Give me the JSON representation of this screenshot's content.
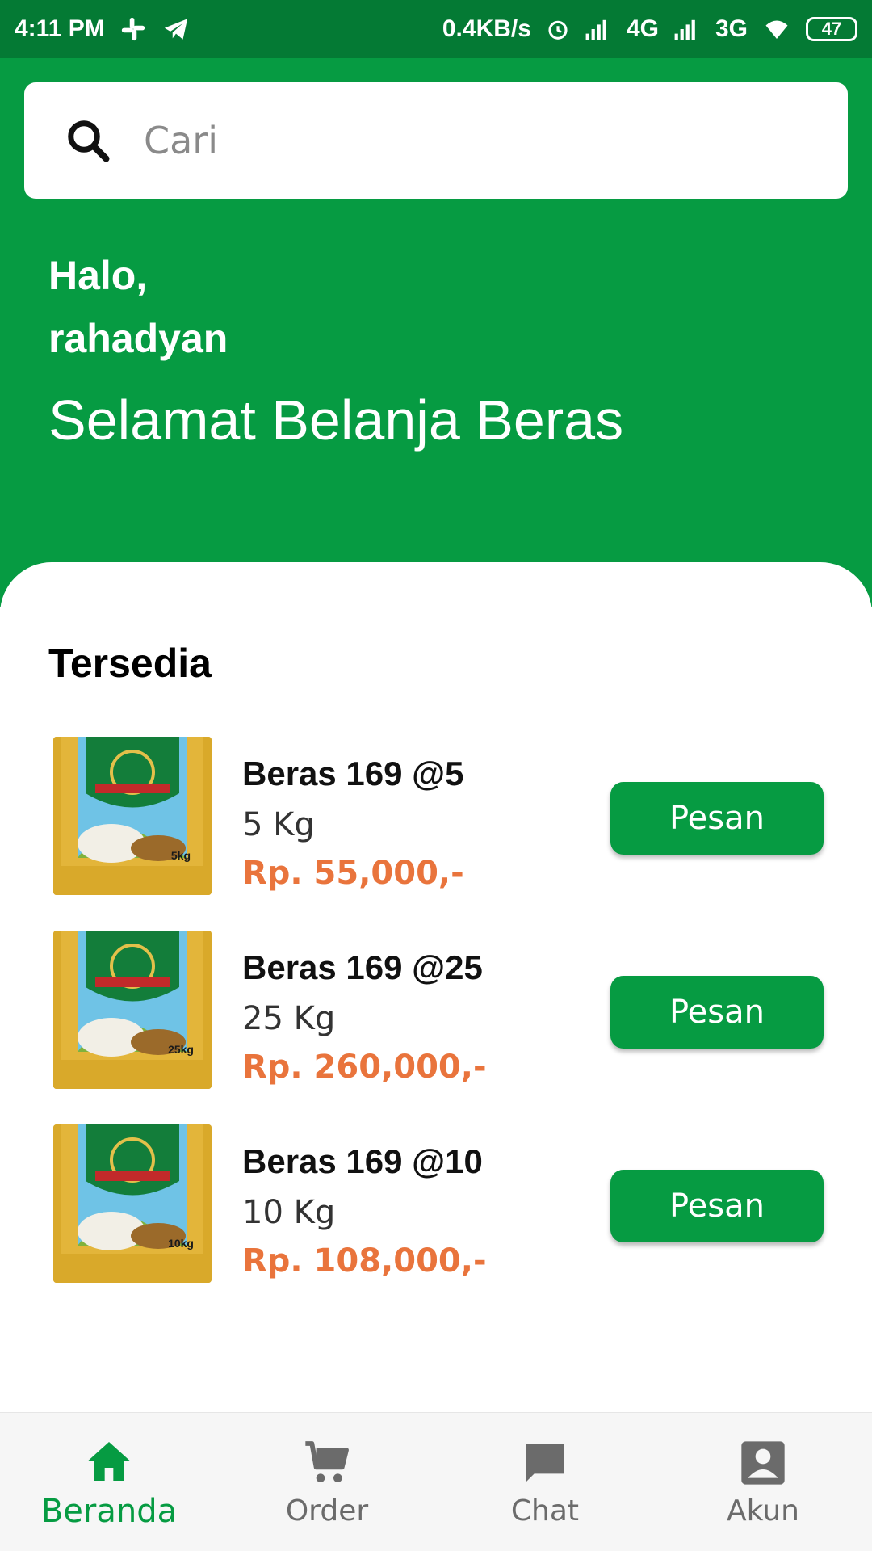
{
  "status_bar": {
    "time": "4:11 PM",
    "network_speed": "0.4KB/s",
    "network_1": "4G",
    "network_2": "3G",
    "battery": "47",
    "icons": [
      "slack-icon",
      "telegram-icon",
      "alarm-icon",
      "signal-icon",
      "wifi-icon",
      "battery-icon"
    ]
  },
  "search": {
    "placeholder": "Cari"
  },
  "greeting": {
    "hello": "Halo,",
    "username": "rahadyan",
    "subtitle": "Selamat Belanja Beras"
  },
  "section": {
    "title": "Tersedia"
  },
  "products": [
    {
      "name": "Beras 169 @5",
      "weight": "5 Kg",
      "price": "Rp. 55,000,-",
      "button": "Pesan",
      "pack_label": "5kg"
    },
    {
      "name": "Beras 169 @25",
      "weight": "25 Kg",
      "price": "Rp. 260,000,-",
      "button": "Pesan",
      "pack_label": "25kg"
    },
    {
      "name": "Beras 169 @10",
      "weight": "10 Kg",
      "price": "Rp. 108,000,-",
      "button": "Pesan",
      "pack_label": "10kg"
    }
  ],
  "bottom_nav": [
    {
      "label": "Beranda",
      "icon": "home-icon",
      "active": true
    },
    {
      "label": "Order",
      "icon": "cart-icon",
      "active": false
    },
    {
      "label": "Chat",
      "icon": "chat-icon",
      "active": false
    },
    {
      "label": "Akun",
      "icon": "account-icon",
      "active": false
    }
  ],
  "colors": {
    "primary_green": "#069b42",
    "status_green": "#047a34",
    "price_orange": "#e9743c",
    "inactive_gray": "#6b6b6b"
  }
}
